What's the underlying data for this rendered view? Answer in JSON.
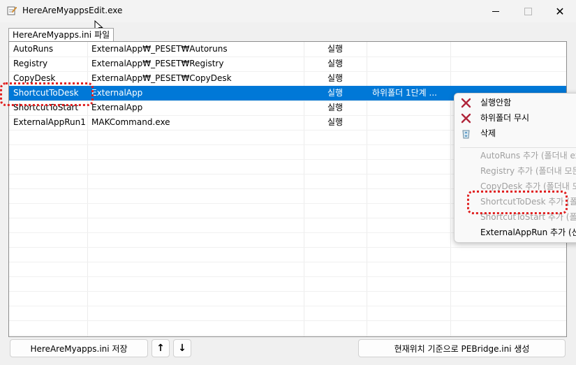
{
  "window": {
    "title": "HereAreMyappsEdit.exe",
    "controls": {
      "minimize": "minimize-icon",
      "maximize": "maximize-icon",
      "close": "close-icon"
    }
  },
  "tab": {
    "filename": "HereAreMyapps.ini",
    "suffix": "파일"
  },
  "table": {
    "rows": [
      {
        "name": "AutoRuns",
        "path": "ExternalApp₩_PESET₩Autoruns",
        "action": "실행",
        "option": "",
        "selected": false
      },
      {
        "name": "Registry",
        "path": "ExternalApp₩_PESET₩Registry",
        "action": "실행",
        "option": "",
        "selected": false
      },
      {
        "name": "CopyDesk",
        "path": "ExternalApp₩_PESET₩CopyDesk",
        "action": "실행",
        "option": "",
        "selected": false
      },
      {
        "name": "ShortcutToDesk",
        "path": "ExternalApp",
        "action": "실행",
        "option": "하위폴더 1단계 ...",
        "selected": true
      },
      {
        "name": "ShortcutToStart",
        "path": "ExternalApp",
        "action": "실행",
        "option": "",
        "selected": false
      },
      {
        "name": "ExternalAppRun1",
        "path": "MAKCommand.exe",
        "action": "실행",
        "option": "",
        "selected": false
      }
    ]
  },
  "context_menu": {
    "items": [
      {
        "label": "실행안함",
        "icon": "x-mark-icon",
        "enabled": true
      },
      {
        "label": "하위폴더 무시",
        "icon": "x-mark-icon",
        "enabled": true
      },
      {
        "label": "삭제",
        "icon": "recycle-bin-icon",
        "enabled": true
      },
      {
        "label": "AutoRuns 추가 (폴더내 ex",
        "enabled": false
      },
      {
        "label": "Registry 추가 (폴더내 모든",
        "enabled": false
      },
      {
        "label": "CopyDesk 추가 (폴더내 모",
        "enabled": false
      },
      {
        "label": "ShortcutToDesk 추가 (폴더",
        "enabled": false
      },
      {
        "label": "ShortcutToStart 추가 (폴더",
        "enabled": false
      },
      {
        "label": "ExternalAppRun 추가 (선택",
        "enabled": true
      }
    ]
  },
  "buttons": {
    "save": "HereAreMyapps.ini 저장",
    "up": "↑",
    "down": "↓",
    "generate": "현재위치 기준으로 PEBridge.ini 생성"
  },
  "colors": {
    "selection": "#0078d7",
    "highlight_dotted": "#e02020",
    "disabled_text": "#a0a0a0"
  }
}
